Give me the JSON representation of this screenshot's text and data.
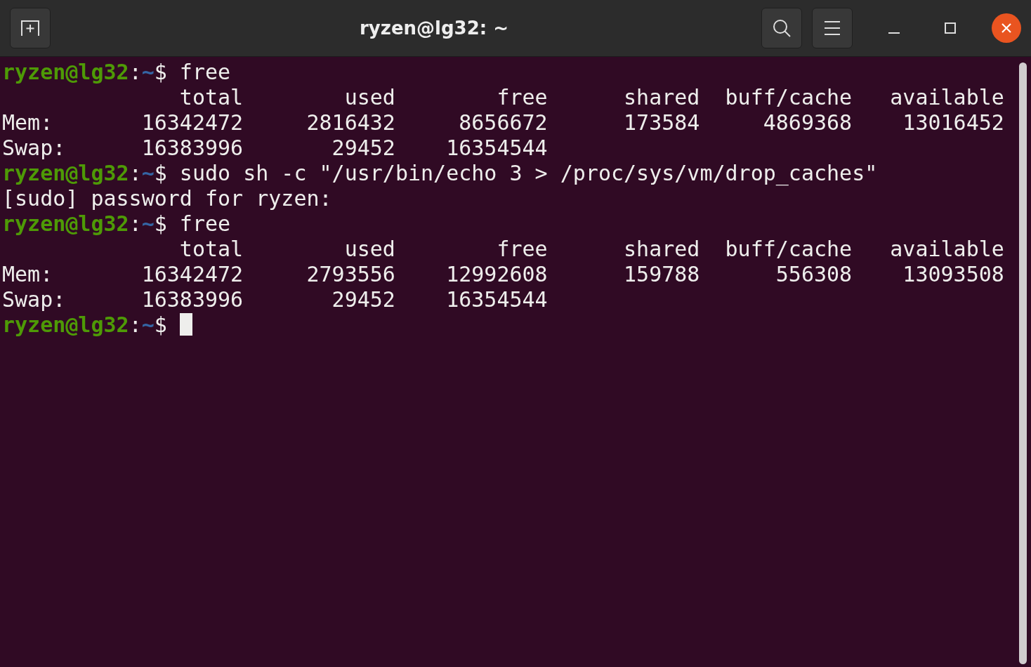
{
  "window": {
    "title": "ryzen@lg32: ~"
  },
  "terminal": {
    "lines": [
      {
        "kind": "prompt",
        "user_host": "ryzen@lg32",
        "separator": ":",
        "path": "~",
        "symbol": "$",
        "command": " free"
      },
      {
        "kind": "output",
        "text": "              total        used        free      shared  buff/cache   available"
      },
      {
        "kind": "output",
        "text": "Mem:       16342472     2816432     8656672      173584     4869368    13016452"
      },
      {
        "kind": "output",
        "text": "Swap:      16383996       29452    16354544"
      },
      {
        "kind": "prompt",
        "user_host": "ryzen@lg32",
        "separator": ":",
        "path": "~",
        "symbol": "$",
        "command": " sudo sh -c \"/usr/bin/echo 3 > /proc/sys/vm/drop_caches\""
      },
      {
        "kind": "output",
        "text": "[sudo] password for ryzen:"
      },
      {
        "kind": "prompt",
        "user_host": "ryzen@lg32",
        "separator": ":",
        "path": "~",
        "symbol": "$",
        "command": " free"
      },
      {
        "kind": "output",
        "text": "              total        used        free      shared  buff/cache   available"
      },
      {
        "kind": "output",
        "text": "Mem:       16342472     2793556    12992608      159788      556308    13093508"
      },
      {
        "kind": "output",
        "text": "Swap:      16383996       29452    16354544"
      },
      {
        "kind": "prompt",
        "user_host": "ryzen@lg32",
        "separator": ":",
        "path": "~",
        "symbol": "$",
        "cursor": true
      }
    ]
  }
}
